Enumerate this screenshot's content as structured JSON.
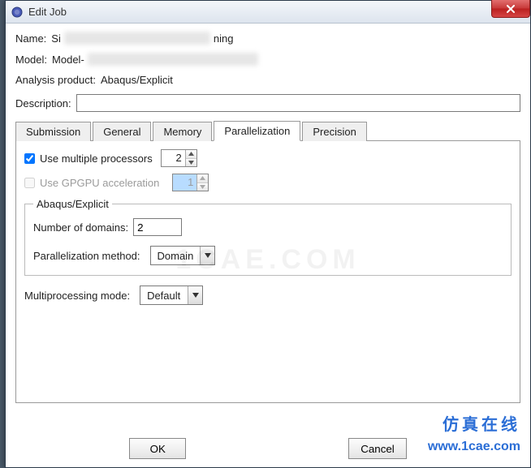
{
  "window": {
    "title": "Edit Job"
  },
  "fields": {
    "name_label": "Name:",
    "name_prefix": "Si",
    "name_suffix": "ning",
    "model_label": "Model:",
    "model_prefix": "Model-",
    "analysis_label": "Analysis product:",
    "analysis_value": "Abaqus/Explicit",
    "description_label": "Description:",
    "description_value": ""
  },
  "tabs": {
    "submission": "Submission",
    "general": "General",
    "memory": "Memory",
    "parallelization": "Parallelization",
    "precision": "Precision",
    "active": "parallelization"
  },
  "parallelization": {
    "use_multi_label": "Use multiple processors",
    "use_multi_checked": true,
    "use_multi_value": "2",
    "use_gpgpu_label": "Use GPGPU acceleration",
    "use_gpgpu_checked": false,
    "use_gpgpu_value": "1",
    "group_legend": "Abaqus/Explicit",
    "domains_label": "Number of domains:",
    "domains_value": "2",
    "method_label": "Parallelization method:",
    "method_value": "Domain",
    "mode_label": "Multiprocessing mode:",
    "mode_value": "Default"
  },
  "buttons": {
    "ok": "OK",
    "cancel": "Cancel"
  },
  "watermark": {
    "center": "1CAE.COM",
    "cn": "仿真在线",
    "url": "www.1cae.com"
  }
}
